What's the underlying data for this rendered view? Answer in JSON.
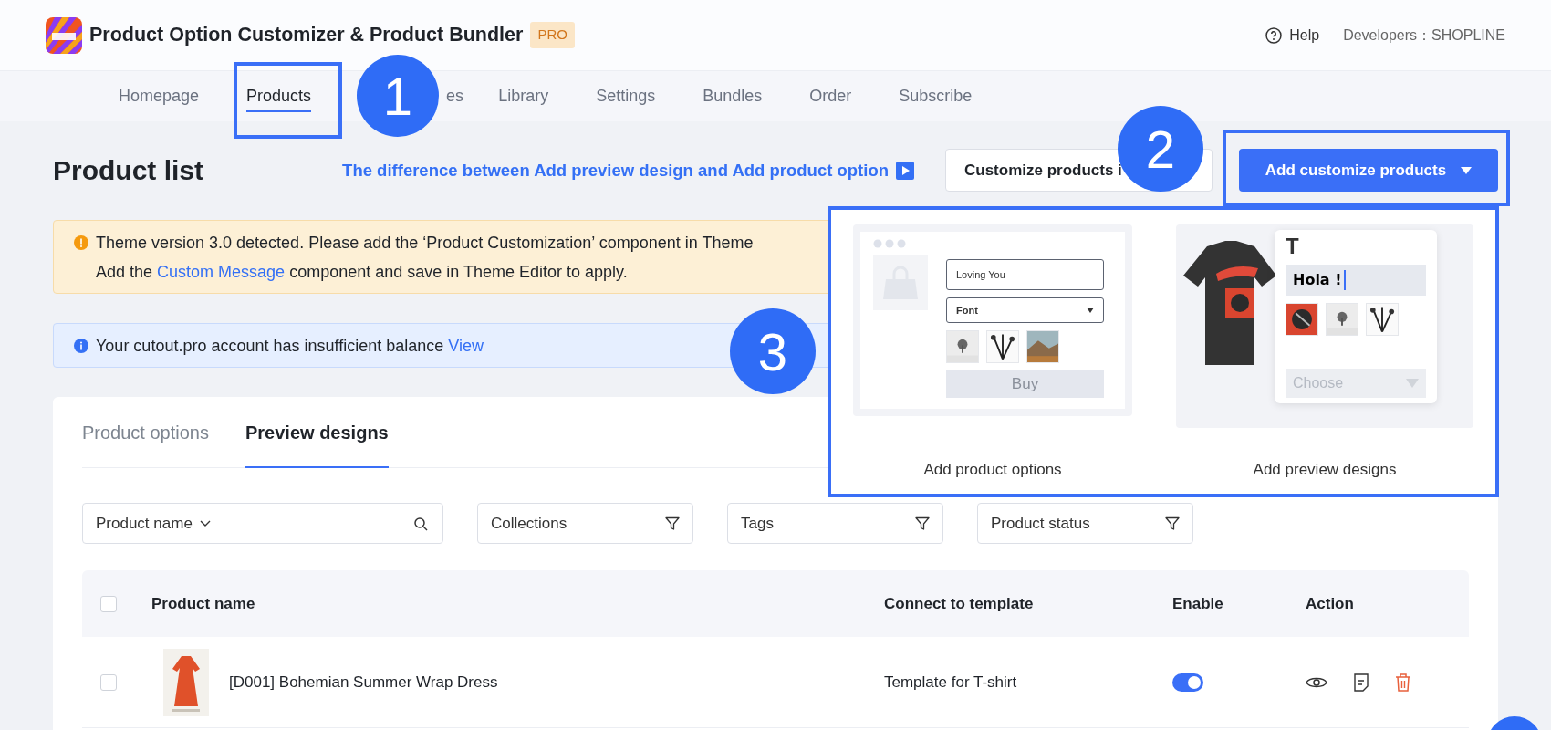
{
  "app": {
    "title": "Product Option Customizer & Product Bundler",
    "badge": "PRO",
    "help": "Help",
    "developers": "Developers：SHOPLINE"
  },
  "nav_tabs": [
    {
      "label": "Homepage",
      "selected": false
    },
    {
      "label": "Products",
      "selected": true
    },
    {
      "label": "es",
      "selected": false
    },
    {
      "label": "Library",
      "selected": false
    },
    {
      "label": "Settings",
      "selected": false
    },
    {
      "label": "Bundles",
      "selected": false
    },
    {
      "label": "Order",
      "selected": false
    },
    {
      "label": "Subscribe",
      "selected": false
    }
  ],
  "page": {
    "title": "Product list",
    "link": "The difference between Add preview design and Add product option",
    "secondary_button": "Customize products i",
    "primary_button": "Add customize products"
  },
  "alerts": [
    {
      "kind": "warning",
      "lines": [
        {
          "before": "Theme version 3.0 detected. Please add the ‘Product Customization’ component in Theme"
        },
        {
          "before": "Add the ",
          "link": "Custom Message",
          "after": " component and save in Theme Editor to apply."
        }
      ]
    },
    {
      "kind": "info",
      "lines": [
        {
          "before": "Your cutout.pro account has insufficient balance ",
          "link": "View"
        }
      ]
    }
  ],
  "content_tabs": [
    {
      "label": "Product options",
      "selected": false
    },
    {
      "label": "Preview designs",
      "selected": true
    }
  ],
  "filters": {
    "search_field": "Product name",
    "selects": [
      "Collections",
      "Tags",
      "Product status"
    ]
  },
  "table": {
    "columns": [
      "Product name",
      "Connect to template",
      "Enable",
      "Action"
    ],
    "all_checked": false,
    "rows": [
      {
        "checked": false,
        "name": "[D001] Bohemian Summer Wrap Dress",
        "template": "Template for T-shirt",
        "enabled": true
      }
    ]
  },
  "dropdown": {
    "options": [
      {
        "kind": "options",
        "label": "Add product options",
        "input": "Loving You",
        "select": "Font",
        "button": "Buy"
      },
      {
        "kind": "preview",
        "label": "Add preview designs",
        "heading": "T",
        "input": "Hola !",
        "select": "Choose"
      }
    ]
  },
  "annotations": [
    {
      "number": "1",
      "kind": "tabs"
    },
    {
      "number": "2",
      "kind": "button"
    },
    {
      "number": "3",
      "kind": "menu"
    }
  ]
}
